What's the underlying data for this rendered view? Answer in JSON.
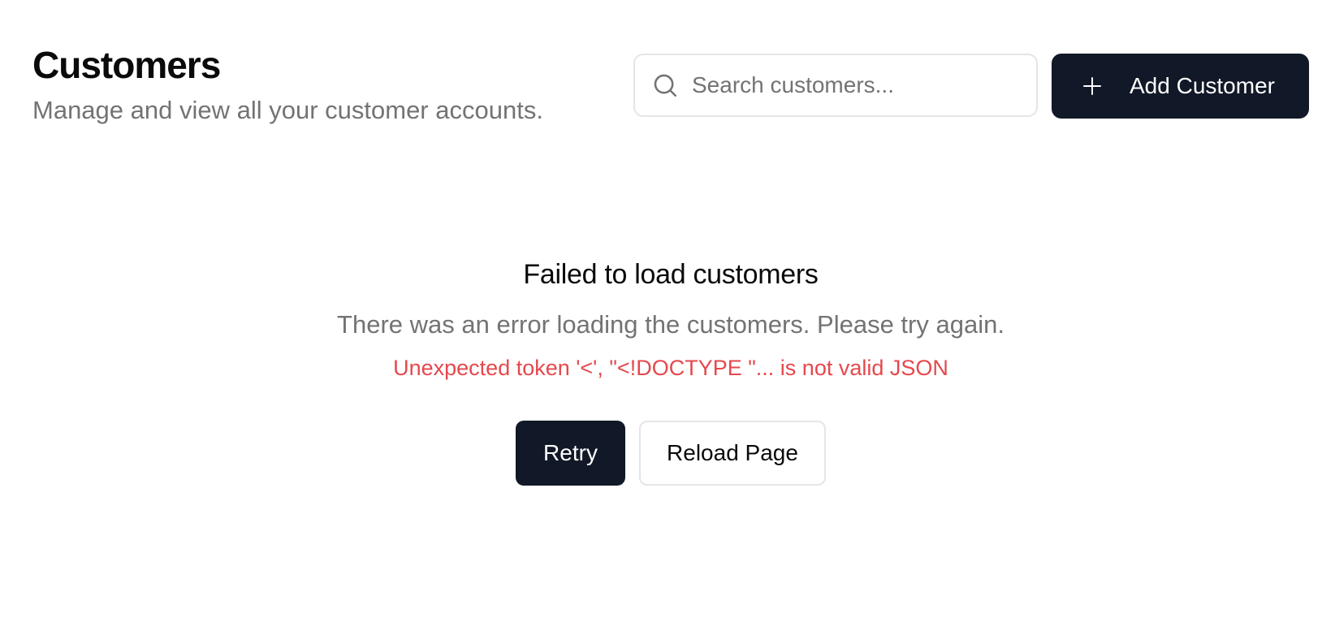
{
  "header": {
    "title": "Customers",
    "subtitle": "Manage and view all your customer accounts."
  },
  "search": {
    "placeholder": "Search customers...",
    "value": "",
    "icon": "search-icon"
  },
  "add_button": {
    "label": "Add Customer",
    "icon": "plus-icon"
  },
  "error": {
    "title": "Failed to load customers",
    "description": "There was an error loading the customers. Please try again.",
    "detail": "Unexpected token '<', \"<!DOCTYPE \"... is not valid JSON"
  },
  "actions": {
    "retry_label": "Retry",
    "reload_label": "Reload Page"
  },
  "colors": {
    "primary": "#111827",
    "muted_text": "#737373",
    "error_text": "#e5484d",
    "border": "#e5e5e5"
  }
}
